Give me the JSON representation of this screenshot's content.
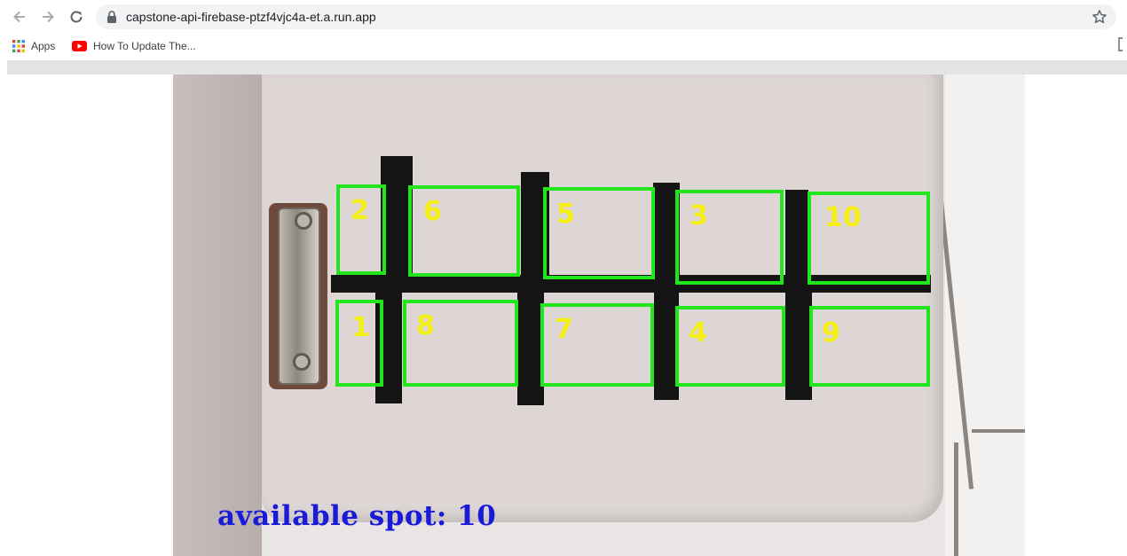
{
  "browser": {
    "url": "capstone-api-firebase-ptzf4vjc4a-et.a.run.app",
    "icons": [
      "back-arrow-icon",
      "forward-arrow-icon",
      "reload-icon",
      "lock-icon",
      "star-icon"
    ],
    "bookmarks": [
      {
        "label": "Apps",
        "icon": "apps-grid-icon"
      },
      {
        "label": "How To Update The...",
        "icon": "youtube-icon"
      }
    ]
  },
  "detection": {
    "box_color": "#22e51c",
    "label_color": "#f5ef12",
    "status_color": "#1a1ad9",
    "slots": [
      {
        "label": "2"
      },
      {
        "label": "6"
      },
      {
        "label": "5"
      },
      {
        "label": "3"
      },
      {
        "label": "10"
      },
      {
        "label": "1"
      },
      {
        "label": "8"
      },
      {
        "label": "7"
      },
      {
        "label": "4"
      },
      {
        "label": "9"
      }
    ],
    "status_text": "available spot: 10"
  }
}
